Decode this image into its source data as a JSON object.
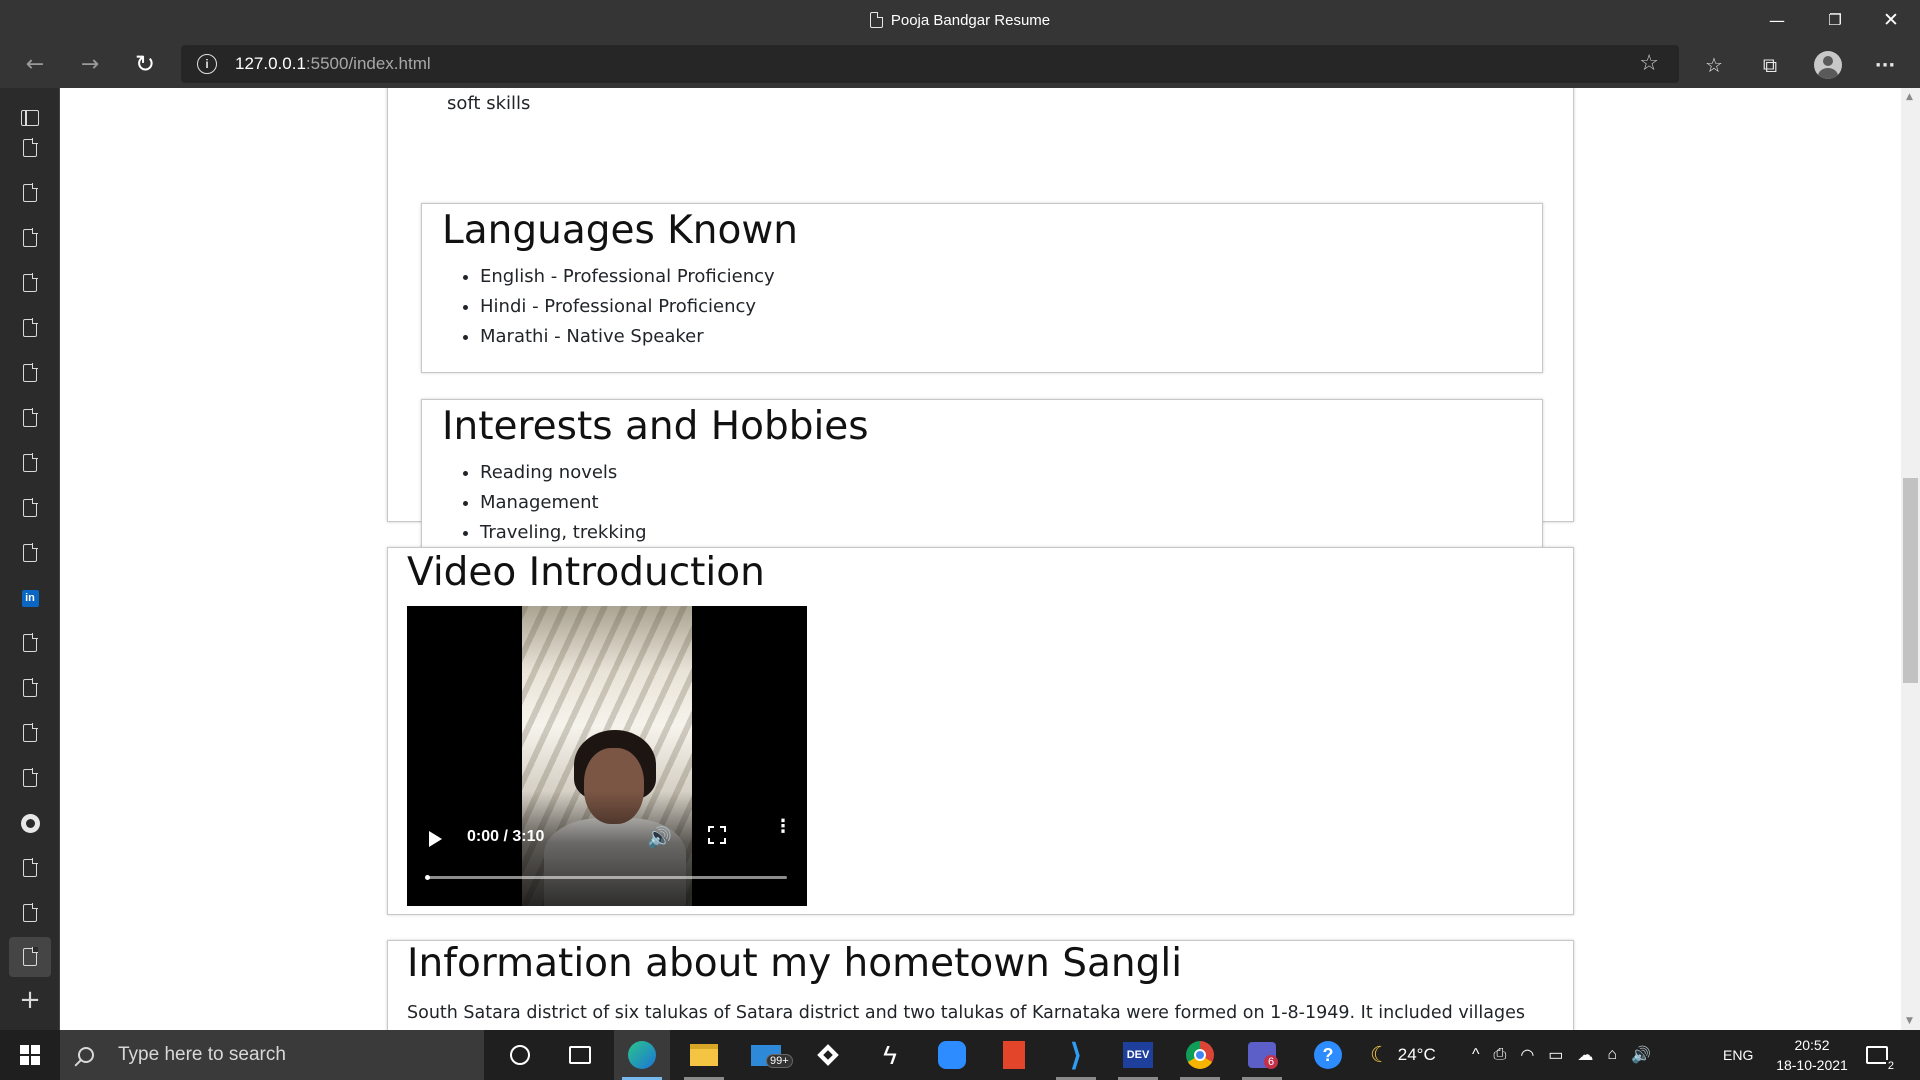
{
  "window": {
    "title": "Pooja Bandgar Resume",
    "minimize": "—",
    "restore": "❐",
    "close": "✕"
  },
  "toolbar": {
    "back": "←",
    "forward": "→",
    "refresh": "↻",
    "info": "i",
    "url_host": "127.0.0.1",
    "url_rest": ":5500/index.html",
    "star": "☆",
    "favorites": "☆",
    "collections": "⧉",
    "more": "···"
  },
  "page": {
    "soft_skills_fragment": "soft skills",
    "languages": {
      "heading": "Languages Known",
      "items": [
        "English - Professional Proficiency",
        "Hindi - Professional Proficiency",
        "Marathi - Native Speaker"
      ]
    },
    "hobbies": {
      "heading": "Interests and Hobbies",
      "items": [
        "Reading novels",
        "Management",
        "Traveling, trekking"
      ]
    },
    "video": {
      "heading": "Video Introduction",
      "time": "0:00 / 3:10",
      "volume": "🔊",
      "more": "⋮"
    },
    "hometown": {
      "heading": "Information about my hometown Sangli",
      "text": "South Satara district of six talukas of Satara district and two talukas of Karnataka were formed on 1-8-1949. It included villages"
    }
  },
  "sidebar": {
    "icons": [
      "tab-actions",
      "page",
      "page",
      "page",
      "page",
      "page",
      "page",
      "page",
      "page",
      "page",
      "page",
      "linkedin",
      "page",
      "page-blocked",
      "page",
      "page",
      "github",
      "page",
      "page",
      "page-selected"
    ],
    "add": "+",
    "linkedin_letters": "in"
  },
  "taskbar": {
    "search_placeholder": "Type here to search",
    "mail_badge": "99+",
    "teams_badge": "6",
    "devc_label": "DEV",
    "temperature": "24°C",
    "language": "ENG",
    "time": "20:52",
    "date": "18-10-2021",
    "notifications": "2",
    "tray_up": "^",
    "tray_icons": [
      "⎙",
      "◠",
      "▭",
      "☁",
      "⌂",
      "🔊"
    ]
  }
}
